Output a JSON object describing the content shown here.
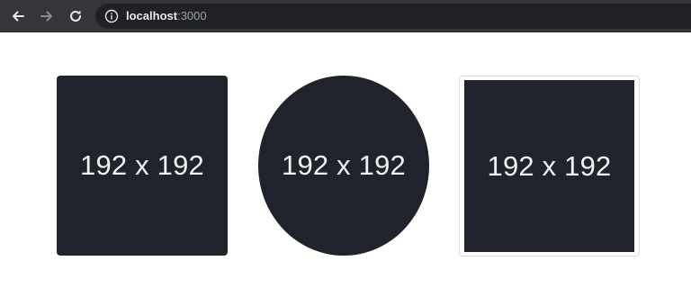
{
  "browser": {
    "url_host": "localhost",
    "url_port": ":3000",
    "icons": {
      "back": "arrow-left-icon",
      "forward": "arrow-right-icon",
      "reload": "reload-icon",
      "info": "info-icon"
    },
    "colors": {
      "toolbar_bg": "#35363a",
      "omnibox_bg": "#202124",
      "icon_active": "#e8eaed",
      "icon_disabled": "#8a8b8e"
    }
  },
  "tiles": [
    {
      "label": "192 x 192",
      "shape": "rounded-square"
    },
    {
      "label": "192 x 192",
      "shape": "circle"
    },
    {
      "label": "192 x 192",
      "shape": "framed-square"
    }
  ],
  "colors": {
    "tile_bg": "#20232b",
    "tile_text": "#f1f1f1",
    "page_bg": "#ffffff"
  }
}
